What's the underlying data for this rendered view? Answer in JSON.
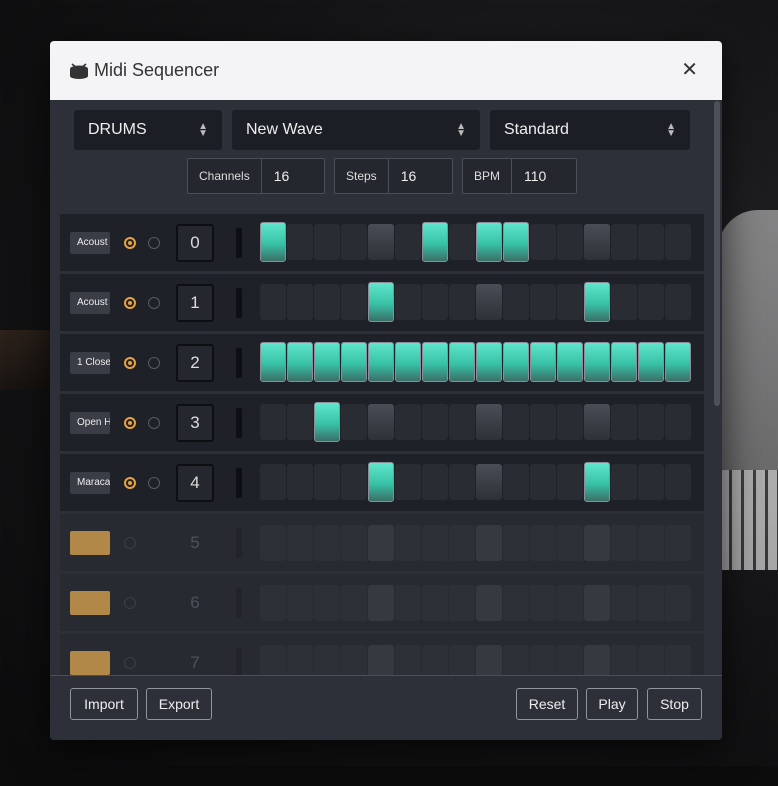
{
  "window": {
    "title": "Midi Sequencer",
    "close_glyph": "✕"
  },
  "selects": [
    {
      "value": "DRUMS"
    },
    {
      "value": "New Wave"
    },
    {
      "value": "Standard"
    }
  ],
  "params": [
    {
      "label": "Channels",
      "value": "16"
    },
    {
      "label": "Steps",
      "value": "16"
    },
    {
      "label": "BPM",
      "value": "110"
    }
  ],
  "rows": [
    {
      "instrument": "Acoust",
      "channel": "0",
      "enabled": true,
      "steps": [
        1,
        0,
        0,
        0,
        0,
        0,
        1,
        0,
        1,
        1,
        0,
        0,
        0,
        0,
        0,
        0
      ]
    },
    {
      "instrument": "Acoust",
      "channel": "1",
      "enabled": true,
      "steps": [
        0,
        0,
        0,
        0,
        1,
        0,
        0,
        0,
        0,
        0,
        0,
        0,
        1,
        0,
        0,
        0
      ]
    },
    {
      "instrument": "1 Close",
      "channel": "2",
      "enabled": true,
      "steps": [
        1,
        1,
        1,
        1,
        1,
        1,
        1,
        1,
        1,
        1,
        1,
        1,
        1,
        1,
        1,
        1
      ]
    },
    {
      "instrument": "Open H",
      "channel": "3",
      "enabled": true,
      "steps": [
        0,
        0,
        1,
        0,
        0,
        0,
        0,
        0,
        0,
        0,
        0,
        0,
        0,
        0,
        0,
        0
      ]
    },
    {
      "instrument": "Maraca",
      "channel": "4",
      "enabled": true,
      "steps": [
        0,
        0,
        0,
        0,
        1,
        0,
        0,
        0,
        0,
        0,
        0,
        0,
        1,
        0,
        0,
        0
      ]
    },
    {
      "instrument": "",
      "channel": "5",
      "enabled": false,
      "steps": [
        0,
        0,
        0,
        0,
        0,
        0,
        0,
        0,
        0,
        0,
        0,
        0,
        0,
        0,
        0,
        0
      ]
    },
    {
      "instrument": "",
      "channel": "6",
      "enabled": false,
      "steps": [
        0,
        0,
        0,
        0,
        0,
        0,
        0,
        0,
        0,
        0,
        0,
        0,
        0,
        0,
        0,
        0
      ]
    },
    {
      "instrument": "",
      "channel": "7",
      "enabled": false,
      "steps": [
        0,
        0,
        0,
        0,
        0,
        0,
        0,
        0,
        0,
        0,
        0,
        0,
        0,
        0,
        0,
        0
      ]
    }
  ],
  "footer": {
    "import_label": "Import",
    "export_label": "Export",
    "reset_label": "Reset",
    "play_label": "Play",
    "stop_label": "Stop"
  },
  "colors": {
    "accent": "#e8a33a",
    "step_on": "#4fd9bd",
    "dialog_bg": "#2d3039"
  }
}
